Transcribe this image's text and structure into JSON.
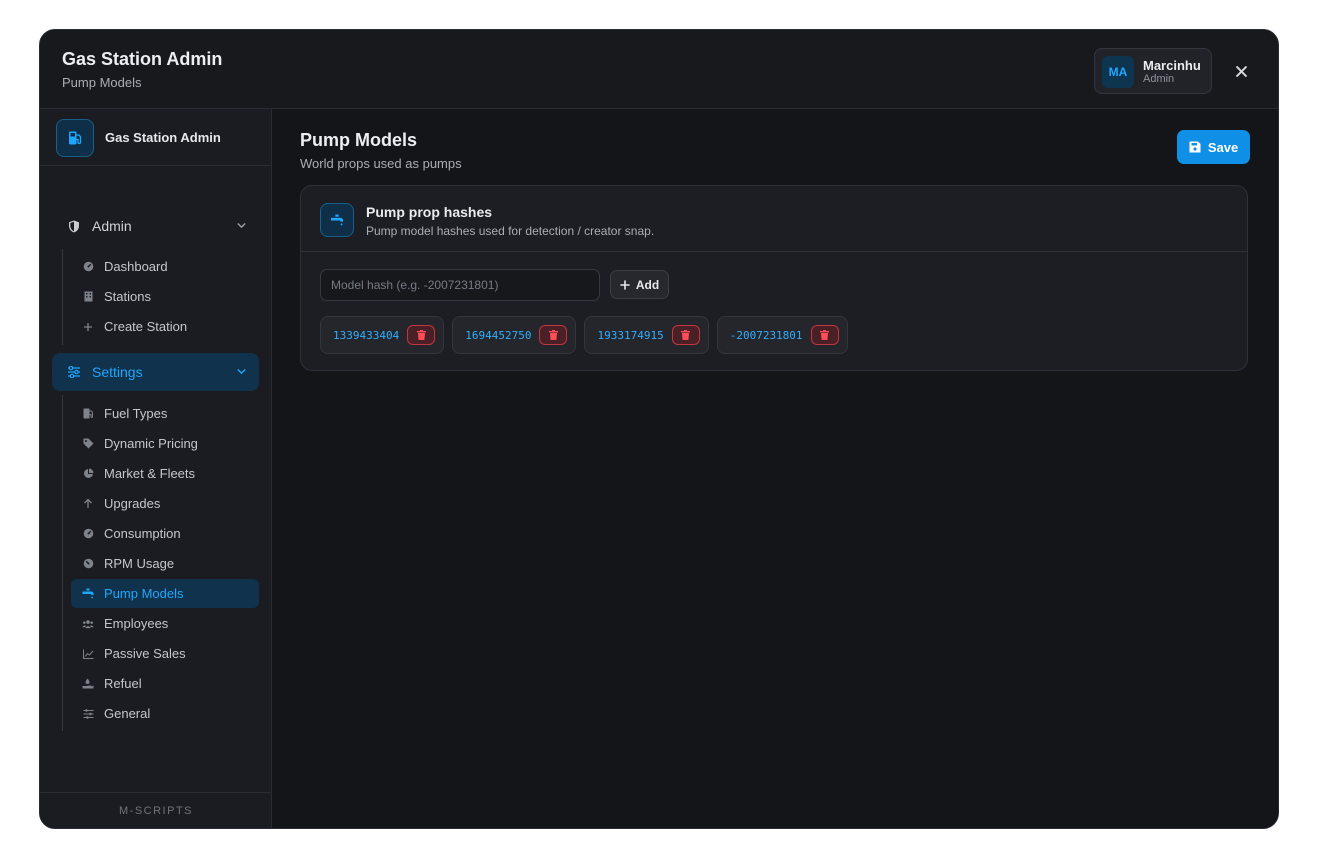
{
  "header": {
    "title": "Gas Station Admin",
    "subtitle": "Pump Models",
    "user": {
      "initials": "MA",
      "name": "Marcinhu",
      "role": "Admin"
    },
    "close_icon": "close-icon"
  },
  "sidebar": {
    "brand": "Gas Station Admin",
    "groups": [
      {
        "label": "Admin",
        "icon": "shield-icon",
        "items": [
          {
            "label": "Dashboard",
            "icon": "gauge-icon"
          },
          {
            "label": "Stations",
            "icon": "building-icon"
          },
          {
            "label": "Create Station",
            "icon": "plus-icon"
          }
        ]
      },
      {
        "label": "Settings",
        "icon": "sliders-icon",
        "items": [
          {
            "label": "Fuel Types",
            "icon": "fuel-icon"
          },
          {
            "label": "Dynamic Pricing",
            "icon": "tags-icon"
          },
          {
            "label": "Market & Fleets",
            "icon": "pie-chart-icon"
          },
          {
            "label": "Upgrades",
            "icon": "arrow-up-icon"
          },
          {
            "label": "Consumption",
            "icon": "gauge-icon"
          },
          {
            "label": "RPM Usage",
            "icon": "gauge-icon"
          },
          {
            "label": "Pump Models",
            "icon": "faucet-icon"
          },
          {
            "label": "Employees",
            "icon": "users-icon"
          },
          {
            "label": "Passive Sales",
            "icon": "line-chart-icon"
          },
          {
            "label": "Refuel",
            "icon": "hand-holding-icon"
          },
          {
            "label": "General",
            "icon": "sliders-icon"
          }
        ]
      }
    ],
    "footer": "M-SCRIPTS"
  },
  "main": {
    "title": "Pump Models",
    "subtitle": "World props used as pumps",
    "save_label": "Save",
    "card": {
      "title": "Pump prop hashes",
      "subtitle": "Pump model hashes used for detection / creator snap.",
      "input_placeholder": "Model hash (e.g. -2007231801)",
      "input_value": "",
      "add_label": "Add",
      "hashes": [
        "1339433404",
        "1694452750",
        "1933174915",
        "-2007231801"
      ]
    }
  },
  "colors": {
    "accent": "#1ea7ff",
    "save": "#0f8fe6",
    "danger": "#e5484d",
    "background": "#16171b"
  }
}
